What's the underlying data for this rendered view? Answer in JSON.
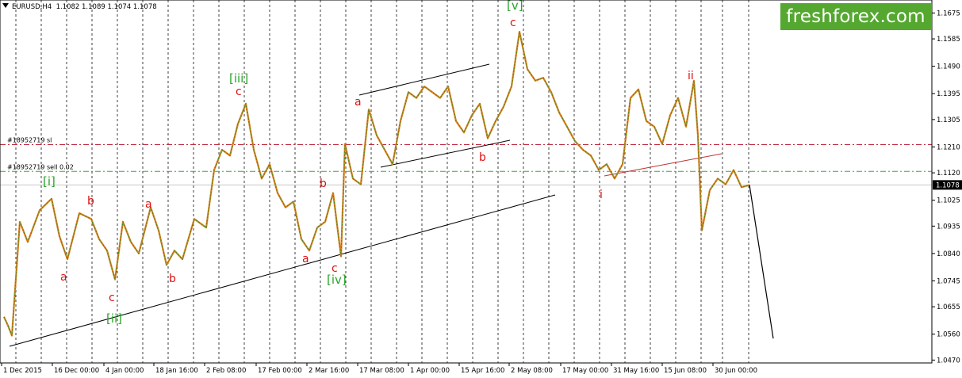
{
  "header": {
    "symbol": "EURUSD,H4",
    "ohlc": "1.1082 1.1089 1.1074 1.1078"
  },
  "brand": {
    "text": "freshforex.com",
    "color": "#54a72f"
  },
  "orders": {
    "sl_label": "#18952719 sl",
    "sell_label": "#18952719 sell 0.02",
    "sl_price": 1.1218,
    "sell_price": 1.1125,
    "sl_color": "#c0283c",
    "sell_color": "#3aa83a"
  },
  "current_price": {
    "label": "1.1078",
    "value": 1.1078
  },
  "chart_data": {
    "type": "line",
    "ylim": [
      1.046,
      1.172
    ],
    "yticks": [
      "1.1675",
      "1.1585",
      "1.1490",
      "1.1395",
      "1.1305",
      "1.1210",
      "1.1120",
      "1.1025",
      "1.0935",
      "1.0840",
      "1.0745",
      "1.0655",
      "1.0560",
      "1.0470"
    ],
    "ytick_values": [
      1.1675,
      1.1585,
      1.149,
      1.1395,
      1.1305,
      1.121,
      1.112,
      1.1025,
      1.0935,
      1.084,
      1.0745,
      1.0655,
      1.056,
      1.047
    ],
    "xticks": [
      "1 Dec 2015",
      "16 Dec 00:00",
      "4 Jan 00:00",
      "18 Jan 16:00",
      "2 Feb 08:00",
      "17 Feb 00:00",
      "2 Mar 16:00",
      "17 Mar 08:00",
      "1 Apr 00:00",
      "15 Apr 16:00",
      "2 May 08:00",
      "17 May 00:00",
      "31 May 16:00",
      "15 Jun 08:00",
      "30 Jun 00:00"
    ],
    "price_series": {
      "name": "EURUSD H4",
      "x": [
        0,
        5,
        10,
        20,
        30,
        45,
        60,
        70,
        80,
        95,
        110,
        120,
        130,
        140,
        150,
        160,
        170,
        185,
        195,
        205,
        215,
        225,
        240,
        255,
        265,
        275,
        285,
        295,
        305,
        315,
        325,
        335,
        345,
        355,
        365,
        375,
        385,
        395,
        405,
        415,
        425,
        430,
        440,
        450,
        460,
        470,
        480,
        490,
        500,
        510,
        520,
        530,
        540,
        550,
        560,
        570,
        580,
        590,
        600,
        610,
        620,
        630,
        640,
        650,
        660,
        670,
        680,
        690,
        700,
        710,
        720,
        730,
        740,
        750,
        760,
        770,
        780,
        790,
        800,
        810,
        820,
        830,
        840,
        850,
        860,
        870,
        875,
        880,
        890,
        900,
        910,
        920,
        930,
        940
      ],
      "y": [
        1.062,
        1.059,
        1.0555,
        1.095,
        1.088,
        1.099,
        1.103,
        1.09,
        1.082,
        1.098,
        1.096,
        1.089,
        1.085,
        1.075,
        1.095,
        1.088,
        1.084,
        1.1,
        1.092,
        1.08,
        1.085,
        1.082,
        1.096,
        1.093,
        1.113,
        1.12,
        1.118,
        1.129,
        1.136,
        1.12,
        1.11,
        1.115,
        1.105,
        1.1,
        1.102,
        1.089,
        1.085,
        1.093,
        1.095,
        1.105,
        1.083,
        1.122,
        1.11,
        1.108,
        1.134,
        1.125,
        1.12,
        1.115,
        1.13,
        1.14,
        1.138,
        1.142,
        1.14,
        1.138,
        1.142,
        1.13,
        1.126,
        1.132,
        1.136,
        1.124,
        1.13,
        1.135,
        1.142,
        1.161,
        1.148,
        1.144,
        1.145,
        1.14,
        1.133,
        1.128,
        1.123,
        1.12,
        1.118,
        1.113,
        1.115,
        1.11,
        1.115,
        1.138,
        1.141,
        1.13,
        1.128,
        1.122,
        1.132,
        1.138,
        1.128,
        1.144,
        1.125,
        1.092,
        1.106,
        1.11,
        1.108,
        1.113,
        1.107,
        1.1078
      ]
    },
    "projection": {
      "x": [
        940,
        975
      ],
      "y": [
        1.1078,
        1.0545
      ]
    },
    "annotations": {
      "red": [
        "a",
        "b",
        "c",
        "a",
        "b",
        "c",
        "a",
        "b",
        "c",
        "a",
        "b",
        "c",
        "i",
        "ii"
      ],
      "green": [
        "[i]",
        "[ii]",
        "[iii]",
        "[iv]",
        "[v]"
      ]
    }
  }
}
